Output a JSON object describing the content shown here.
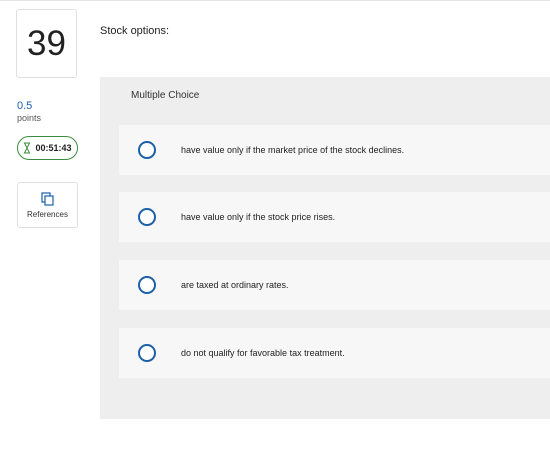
{
  "question": {
    "number": "39",
    "points_value": "0.5",
    "points_label": "points",
    "timer": "00:51:43",
    "timer_icon": "hourglass-icon",
    "references_label": "References",
    "references_icon": "copy-icon",
    "text": "Stock options:"
  },
  "answer_panel": {
    "title": "Multiple Choice",
    "choices": [
      {
        "label": "have value only if the market price of the stock declines."
      },
      {
        "label": "have value only if the stock price rises."
      },
      {
        "label": "are taxed at ordinary rates."
      },
      {
        "label": "do not qualify for favorable tax treatment."
      }
    ]
  },
  "colors": {
    "accent_blue": "#1a5fa8",
    "timer_green": "#3d8b3d",
    "panel_bg": "#eeeeee",
    "choice_bg": "#f7f7f7"
  }
}
